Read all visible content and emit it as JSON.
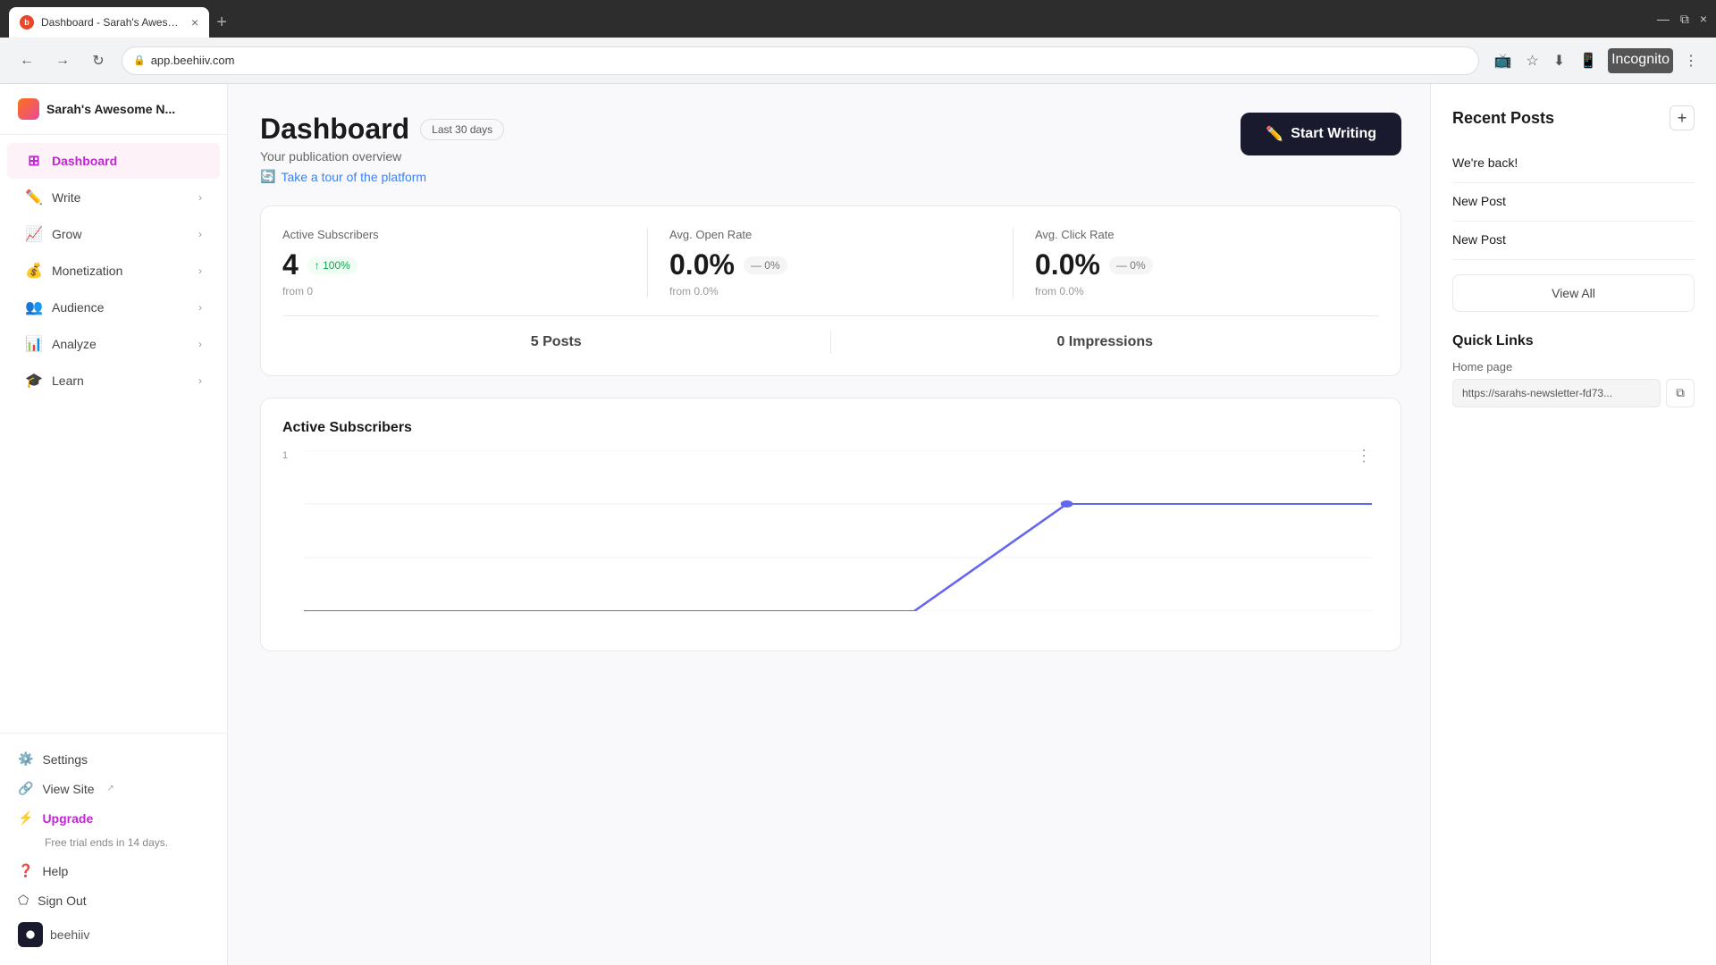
{
  "browser": {
    "tab_title": "Dashboard - Sarah's Awesome N...",
    "tab_close": "×",
    "new_tab": "+",
    "window_minimize": "—",
    "window_restore": "⧉",
    "window_close": "×",
    "nav_back": "←",
    "nav_forward": "→",
    "nav_refresh": "↻",
    "address": "app.beehiiv.com",
    "incognito_label": "Incognito",
    "toolbar_menu": "⋮"
  },
  "sidebar": {
    "publication_name": "Sarah's Awesome N...",
    "nav_items": [
      {
        "id": "dashboard",
        "label": "Dashboard",
        "icon": "⊞",
        "active": true,
        "has_chevron": false
      },
      {
        "id": "write",
        "label": "Write",
        "icon": "✏️",
        "active": false,
        "has_chevron": true
      },
      {
        "id": "grow",
        "label": "Grow",
        "icon": "📈",
        "active": false,
        "has_chevron": true
      },
      {
        "id": "monetization",
        "label": "Monetization",
        "icon": "💰",
        "active": false,
        "has_chevron": true
      },
      {
        "id": "audience",
        "label": "Audience",
        "icon": "👥",
        "active": false,
        "has_chevron": true
      },
      {
        "id": "analyze",
        "label": "Analyze",
        "icon": "📊",
        "active": false,
        "has_chevron": true
      },
      {
        "id": "learn",
        "label": "Learn",
        "icon": "🎓",
        "active": false,
        "has_chevron": true
      }
    ],
    "bottom_items": [
      {
        "id": "settings",
        "label": "Settings",
        "icon": "⚙️"
      },
      {
        "id": "view-site",
        "label": "View Site",
        "icon": "🔗",
        "external": true
      }
    ],
    "upgrade_label": "Upgrade",
    "upgrade_icon": "⚡",
    "trial_notice": "Free trial ends in 14 days.",
    "help_label": "Help",
    "help_icon": "❓",
    "sign_out_label": "Sign Out",
    "sign_out_icon": "⬠",
    "brand_name": "beehiiv"
  },
  "main": {
    "page_title": "Dashboard",
    "last_30_label": "Last 30 days",
    "subtitle": "Your publication overview",
    "tour_link": "Take a tour of the platform",
    "start_writing_label": "Start Writing",
    "stats": {
      "active_subscribers_label": "Active Subscribers",
      "active_subscribers_value": "4",
      "active_subscribers_badge": "↑ 100%",
      "active_subscribers_from": "from 0",
      "avg_open_rate_label": "Avg. Open Rate",
      "avg_open_rate_value": "0.0%",
      "avg_open_rate_badge": "— 0%",
      "avg_open_rate_from": "from 0.0%",
      "avg_click_rate_label": "Avg. Click Rate",
      "avg_click_rate_value": "0.0%",
      "avg_click_rate_badge": "— 0%",
      "avg_click_rate_from": "from 0.0%",
      "posts_label": "5 Posts",
      "impressions_label": "0 Impressions"
    },
    "chart": {
      "title": "Active Subscribers",
      "y_axis": [
        "1",
        ""
      ],
      "dots_menu": "⋮"
    }
  },
  "right_panel": {
    "recent_posts_title": "Recent Posts",
    "add_post_icon": "+",
    "posts": [
      {
        "title": "We're back!"
      },
      {
        "title": "New Post"
      },
      {
        "title": "New Post"
      }
    ],
    "view_all_label": "View All",
    "quick_links_title": "Quick Links",
    "home_page_label": "Home page",
    "home_page_url": "https://sarahs-newsletter-fd73...",
    "copy_icon": "⧉"
  }
}
